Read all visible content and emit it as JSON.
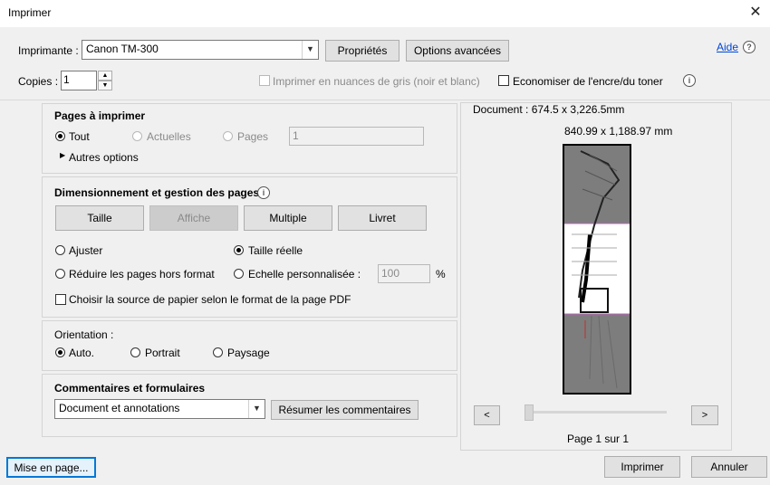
{
  "window": {
    "title": "Imprimer"
  },
  "printer": {
    "label": "Imprimante :",
    "selected": "Canon TM-300",
    "properties_btn": "Propriétés",
    "advanced_btn": "Options avancées",
    "help_link": "Aide"
  },
  "copies": {
    "label": "Copies :",
    "value": "1",
    "grayscale_label": "Imprimer en nuances de gris (noir et blanc)",
    "save_ink_label": "Economiser de l'encre/du toner"
  },
  "pages": {
    "heading": "Pages à imprimer",
    "opt_all": "Tout",
    "opt_current": "Actuelles",
    "opt_pages": "Pages",
    "pages_value": "1",
    "more_options": "Autres options"
  },
  "sizing": {
    "heading": "Dimensionnement et gestion des pages",
    "tabs": [
      "Taille",
      "Affiche",
      "Multiple",
      "Livret"
    ],
    "fit": "Ajuster",
    "actual": "Taille réelle",
    "shrink": "Réduire les pages hors format",
    "custom_scale": "Echelle personnalisée :",
    "scale_value": "100",
    "percent": "%",
    "paper_source": "Choisir la source de papier selon le format de la page PDF"
  },
  "orientation": {
    "heading": "Orientation :",
    "auto": "Auto.",
    "portrait": "Portrait",
    "landscape": "Paysage"
  },
  "comments": {
    "heading": "Commentaires et formulaires",
    "selected": "Document et annotations",
    "summarize_btn": "Résumer les commentaires"
  },
  "preview": {
    "document_size": "Document : 674.5 x 3,226.5mm",
    "paper_size": "840.99 x 1,188.97 mm",
    "prev_btn": "<",
    "next_btn": ">",
    "page_info": "Page 1 sur 1"
  },
  "footer": {
    "page_setup_btn": "Mise en page...",
    "print_btn": "Imprimer",
    "cancel_btn": "Annuler"
  }
}
